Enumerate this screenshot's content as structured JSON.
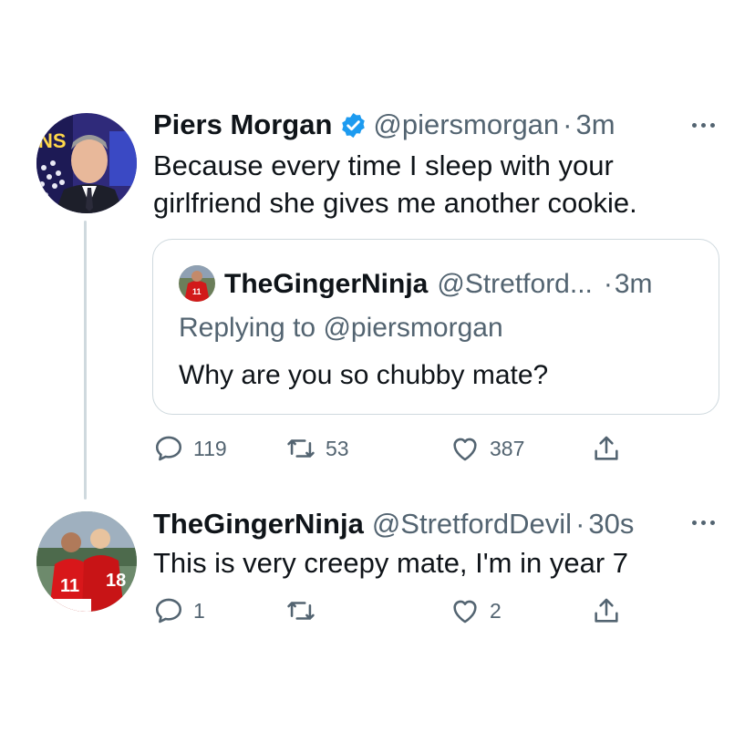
{
  "tweet": {
    "author_name": "Piers Morgan",
    "handle": "@piersmorgan",
    "separator": "·",
    "time": "3m",
    "verified": true,
    "text_line1": "Because every time I sleep with your",
    "text_line2": "girlfriend she gives me another cookie.",
    "avatar_icon": "avatar-piers-morgan",
    "quoted": {
      "author_name": "TheGingerNinja",
      "handle": "@Stretford...",
      "separator": "·",
      "time": "3m",
      "replying_prefix": "Replying to",
      "replying_to": "@piersmorgan",
      "text": "Why are you so chubby mate?"
    },
    "actions": {
      "replies": "119",
      "retweets": "53",
      "likes": "387"
    }
  },
  "reply": {
    "author_name": "TheGingerNinja",
    "handle": "@StretfordDevil",
    "separator": "·",
    "time": "30s",
    "text": "This is very creepy mate, I'm in year 7",
    "avatar_icon": "avatar-ginger-ninja",
    "actions": {
      "replies": "1",
      "retweets": "",
      "likes": "2"
    }
  },
  "colors": {
    "text": "#0f1419",
    "secondary": "#536471",
    "border": "#cfd9de",
    "verified_blue": "#1d9bf0"
  },
  "icons": {
    "reply": "reply-icon",
    "retweet": "retweet-icon",
    "like": "heart-icon",
    "share": "share-icon",
    "more": "more-options-icon",
    "verified": "verified-badge-icon"
  }
}
